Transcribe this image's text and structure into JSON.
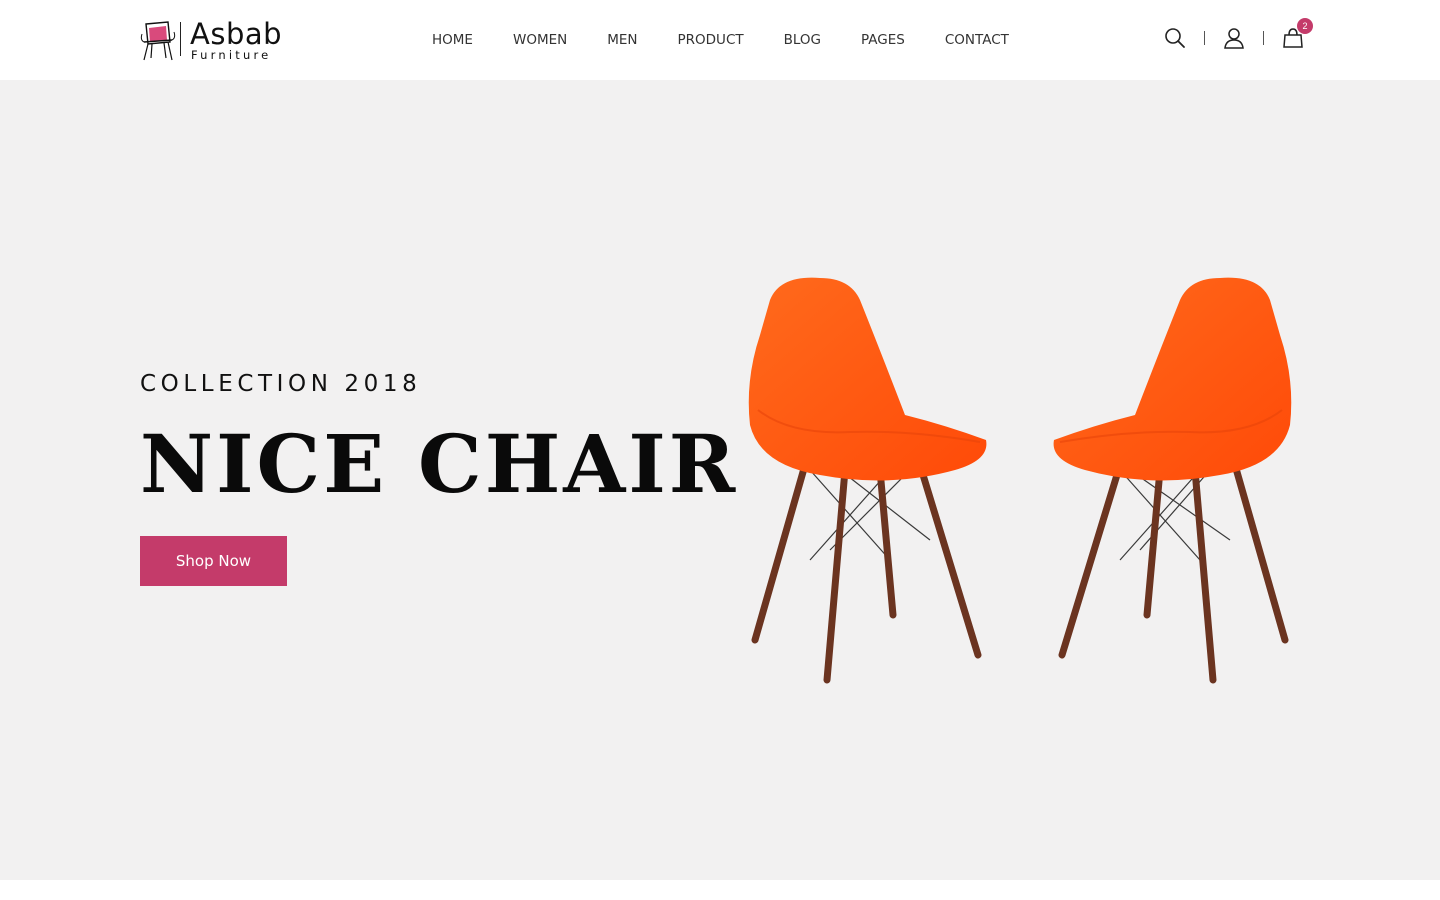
{
  "brand": {
    "name": "Asbab",
    "tagline": "Furniture",
    "accent_color": "#c43b6a",
    "logo_icon": "chair-icon"
  },
  "nav": {
    "items": [
      {
        "label": "HOME"
      },
      {
        "label": "WOMEN"
      },
      {
        "label": "MEN"
      },
      {
        "label": "PRODUCT"
      },
      {
        "label": "BLOG"
      },
      {
        "label": "PAGES"
      },
      {
        "label": "CONTACT"
      }
    ]
  },
  "header_icons": {
    "search": "search-icon",
    "account": "user-icon",
    "cart": "shopping-bag-icon",
    "cart_count": "2"
  },
  "hero": {
    "eyebrow": "COLLECTION 2018",
    "headline": "NICE CHAIR",
    "cta_label": "Shop Now",
    "background_color": "#f2f1f1",
    "product_color": "#ff5a12",
    "leg_color": "#6b3420"
  }
}
